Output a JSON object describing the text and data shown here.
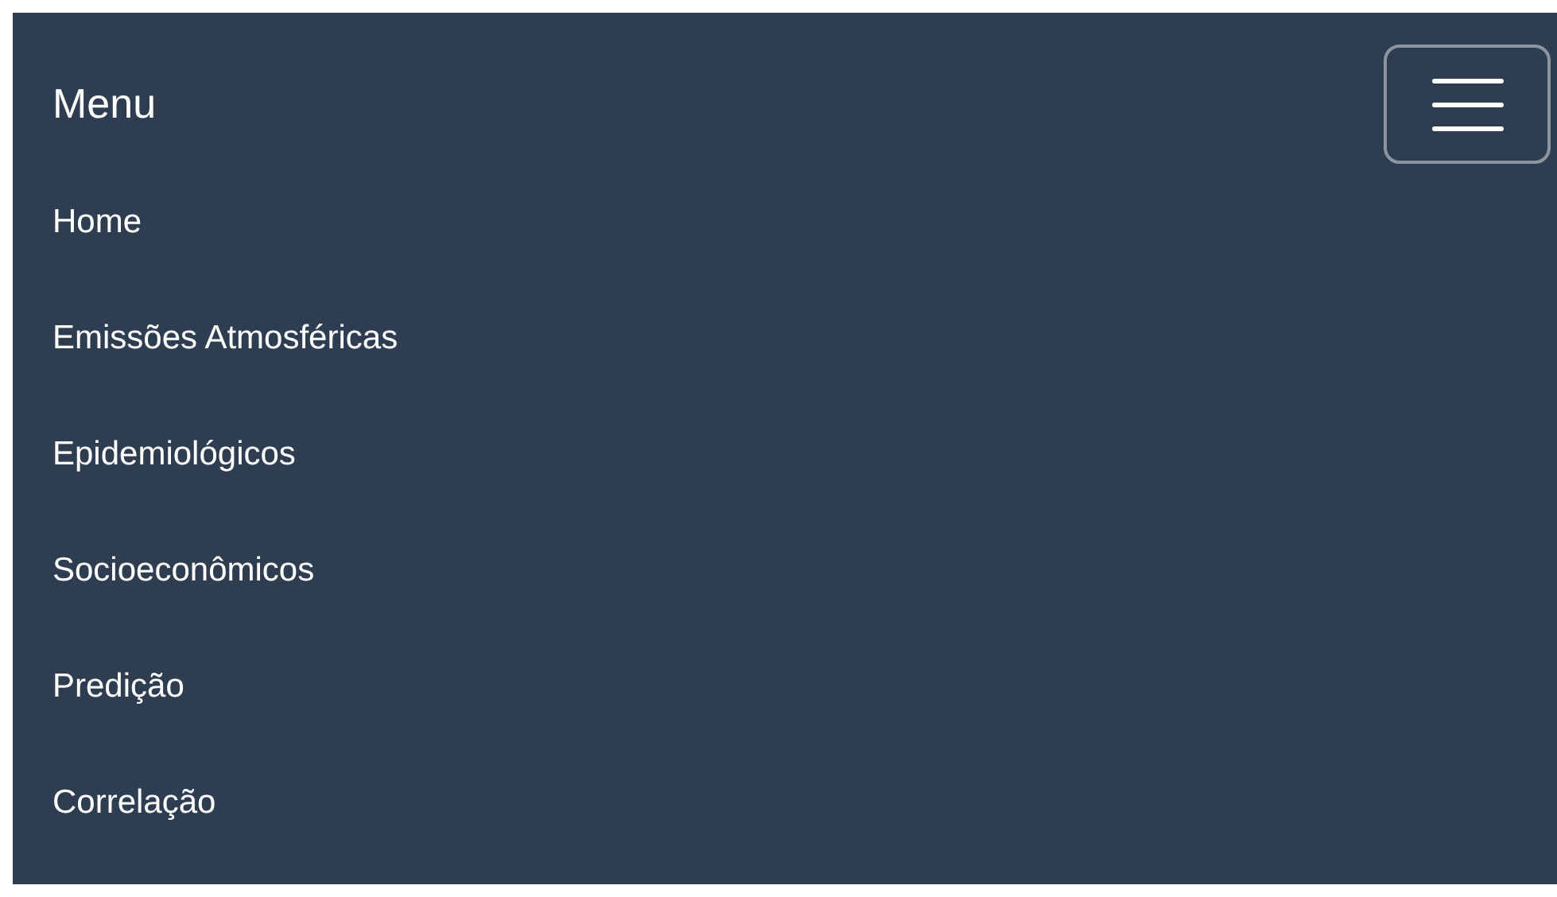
{
  "menu": {
    "title": "Menu",
    "items": [
      {
        "label": "Home"
      },
      {
        "label": "Emissões Atmosféricas"
      },
      {
        "label": "Epidemiológicos"
      },
      {
        "label": "Socioeconômicos"
      },
      {
        "label": "Predição"
      },
      {
        "label": "Correlação"
      }
    ]
  }
}
